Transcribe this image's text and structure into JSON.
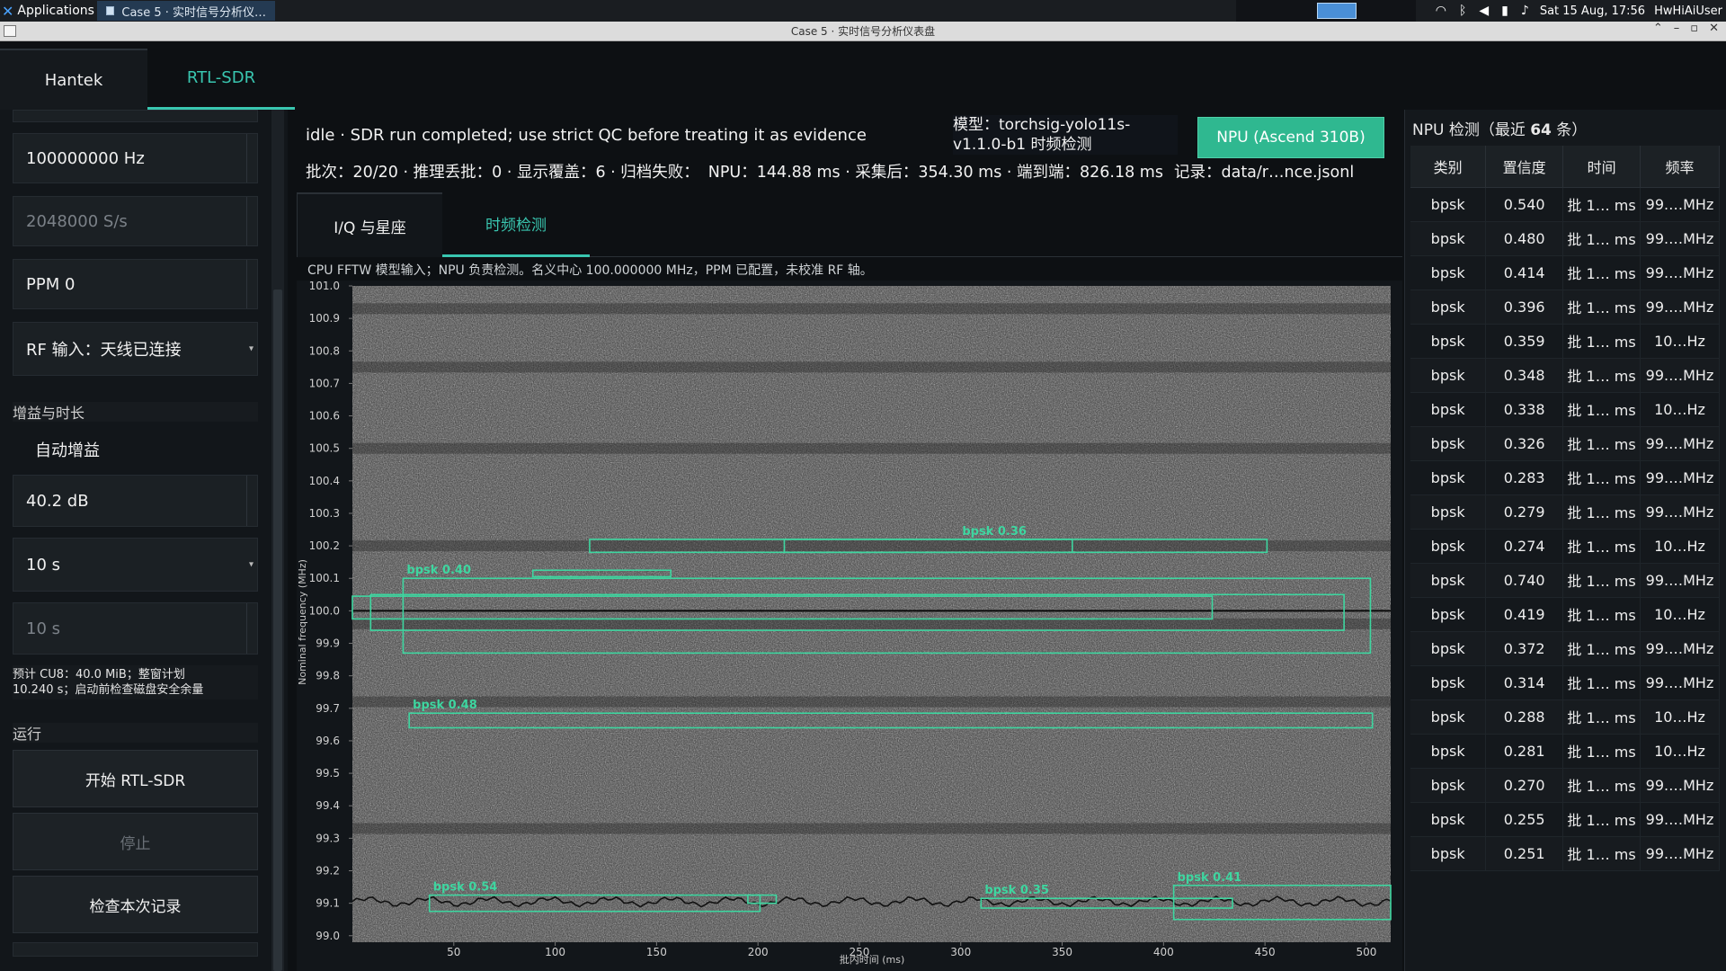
{
  "system_bar": {
    "apps_label": "Applications",
    "task_label": "Case 5 · 实时信号分析仪…",
    "clock": "Sat 15 Aug, 17:56",
    "user": "HwHiAiUser",
    "tray_icons": [
      "wifi-icon",
      "bluetooth-icon",
      "volume-icon",
      "battery-icon",
      "bell-icon"
    ]
  },
  "window": {
    "title": "Case 5 · 实时信号分析仪表盘"
  },
  "device_tabs": [
    {
      "label": "Hantek",
      "active": false
    },
    {
      "label": "RTL-SDR",
      "active": true
    }
  ],
  "left_panel": {
    "center_freq": "100000000 Hz",
    "sample_rate": "2048000 S/s",
    "ppm": "PPM 0",
    "rf_input": "RF 输入：天线已连接",
    "gain_section": "增益与时长",
    "auto_gain": "自动增益",
    "gain_value": "40.2 dB",
    "duration": "10 s",
    "duration_readonly": "10 s",
    "estimate_note_line1": "预计 CU8：40.0 MiB；整窗计划",
    "estimate_note_line2": "10.240 s；启动前检查磁盘安全余量",
    "run_section": "运行",
    "start_button": "开始 RTL-SDR",
    "stop_button": "停止",
    "check_button": "检查本次记录"
  },
  "status": {
    "message": "idle · SDR run completed; use strict QC before treating it as evidence",
    "model_line1": "模型：torchsig-yolo11s-",
    "model_line2": "v1.1.0-b1 时频检测",
    "npu_button": "NPU (Ascend 310B)",
    "batch": "批次：20/20 · 推理丢批：0 · 显示覆盖：6 · 归档失败：",
    "timing": "NPU：144.88 ms · 采集后：354.30 ms · 端到端：826.18 ms",
    "record": "记录：data/r…nce.jsonl"
  },
  "sub_tabs": [
    {
      "label": "I/Q 与星座",
      "active": false
    },
    {
      "label": "时频检测",
      "active": true
    }
  ],
  "plot_caption": "CPU FFTW 模型输入；NPU 负责检测。名义中心 100.000000 MHz，PPM 已配置，未校准 RF 轴。",
  "chart_data": {
    "type": "heatmap",
    "xlabel": "批内时间 (ms)",
    "ylabel": "Nominal frequency (MHz)",
    "xlim": [
      0,
      512
    ],
    "ylim": [
      98.98,
      101.0
    ],
    "x_ticks": [
      50,
      100,
      150,
      200,
      250,
      300,
      350,
      400,
      450,
      500
    ],
    "y_ticks": [
      99.0,
      99.1,
      99.2,
      99.3,
      99.4,
      99.5,
      99.6,
      99.7,
      99.8,
      99.9,
      100.0,
      100.1,
      100.2,
      100.3,
      100.4,
      100.5,
      100.6,
      100.7,
      100.8,
      100.9,
      101.0
    ],
    "box_color": "#3ed6a0",
    "detections": [
      {
        "label": "bpsk 0.36",
        "x0": 117,
        "x1": 451,
        "y0": 100.18,
        "y1": 100.22
      },
      {
        "label": "",
        "x0": 213,
        "x1": 355,
        "y0": 100.18,
        "y1": 100.22
      },
      {
        "label": "",
        "x0": 89,
        "x1": 157,
        "y0": 100.105,
        "y1": 100.125
      },
      {
        "label": "bpsk 0.40",
        "x0": 25,
        "x1": 502,
        "y0": 99.87,
        "y1": 100.1
      },
      {
        "label": "",
        "x0": 0,
        "x1": 424,
        "y0": 99.975,
        "y1": 100.045
      },
      {
        "label": "",
        "x0": 9,
        "x1": 489,
        "y0": 99.94,
        "y1": 100.05
      },
      {
        "label": "bpsk 0.48",
        "x0": 28,
        "x1": 503,
        "y0": 99.64,
        "y1": 99.685
      },
      {
        "label": "bpsk 0.54",
        "x0": 38,
        "x1": 201,
        "y0": 99.075,
        "y1": 99.125
      },
      {
        "label": "",
        "x0": 195,
        "x1": 209,
        "y0": 99.1,
        "y1": 99.125
      },
      {
        "label": "bpsk 0.35",
        "x0": 310,
        "x1": 434,
        "y0": 99.085,
        "y1": 99.115
      },
      {
        "label": "bpsk 0.41",
        "x0": 405,
        "x1": 512,
        "y0": 99.05,
        "y1": 99.155
      }
    ]
  },
  "right_panel": {
    "title_prefix": "NPU 检测（最近 ",
    "count": "64",
    "title_suffix": " 条）",
    "columns": [
      "类别",
      "置信度",
      "时间",
      "频率"
    ],
    "rows": [
      [
        "bpsk",
        "0.540",
        "批 1… ms",
        "99.…MHz"
      ],
      [
        "bpsk",
        "0.480",
        "批 1… ms",
        "99.…MHz"
      ],
      [
        "bpsk",
        "0.414",
        "批 1… ms",
        "99.…MHz"
      ],
      [
        "bpsk",
        "0.396",
        "批 1… ms",
        "99.…MHz"
      ],
      [
        "bpsk",
        "0.359",
        "批 1… ms",
        "10…Hz"
      ],
      [
        "bpsk",
        "0.348",
        "批 1… ms",
        "99.…MHz"
      ],
      [
        "bpsk",
        "0.338",
        "批 1… ms",
        "10…Hz"
      ],
      [
        "bpsk",
        "0.326",
        "批 1… ms",
        "99.…MHz"
      ],
      [
        "bpsk",
        "0.283",
        "批 1… ms",
        "99.…MHz"
      ],
      [
        "bpsk",
        "0.279",
        "批 1… ms",
        "99.…MHz"
      ],
      [
        "bpsk",
        "0.274",
        "批 1… ms",
        "10…Hz"
      ],
      [
        "bpsk",
        "0.740",
        "批 1… ms",
        "99.…MHz"
      ],
      [
        "bpsk",
        "0.419",
        "批 1… ms",
        "10…Hz"
      ],
      [
        "bpsk",
        "0.372",
        "批 1… ms",
        "99.…MHz"
      ],
      [
        "bpsk",
        "0.314",
        "批 1… ms",
        "99.…MHz"
      ],
      [
        "bpsk",
        "0.288",
        "批 1… ms",
        "10…Hz"
      ],
      [
        "bpsk",
        "0.281",
        "批 1… ms",
        "10…Hz"
      ],
      [
        "bpsk",
        "0.270",
        "批 1… ms",
        "99.…MHz"
      ],
      [
        "bpsk",
        "0.255",
        "批 1… ms",
        "99.…MHz"
      ],
      [
        "bpsk",
        "0.251",
        "批 1… ms",
        "99.…MHz"
      ]
    ]
  }
}
